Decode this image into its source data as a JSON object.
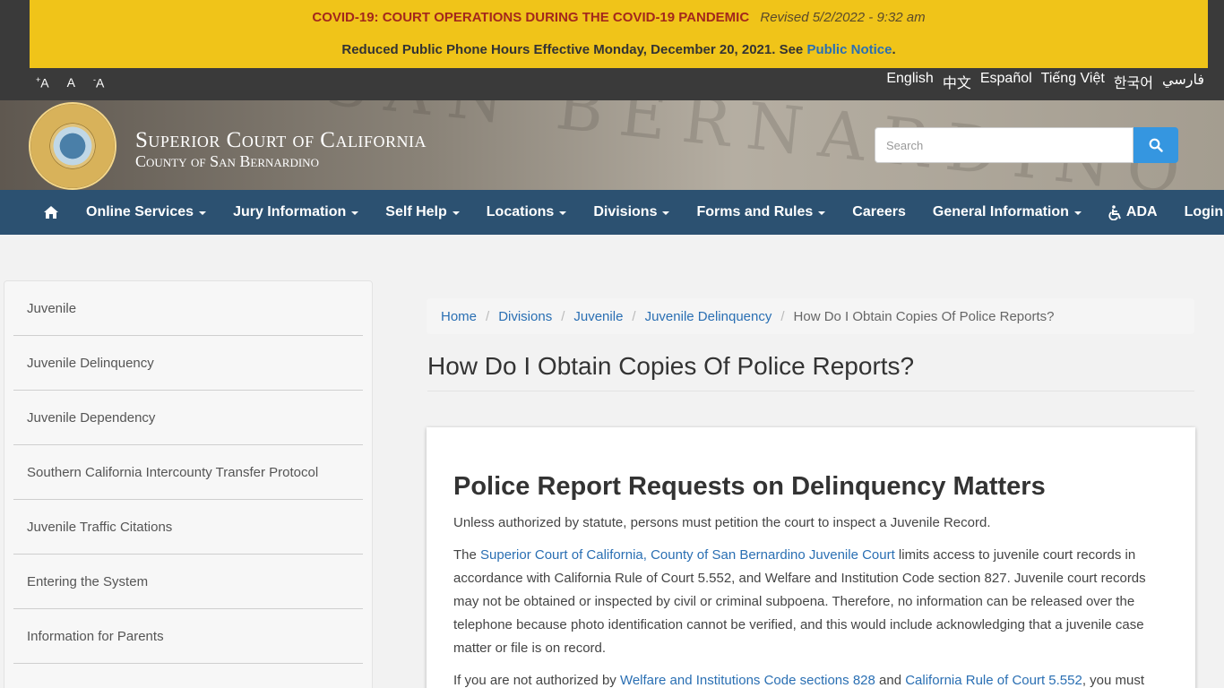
{
  "alert": {
    "title": "COVID-19: COURT OPERATIONS DURING THE COVID-19 PANDEMIC",
    "revised": "Revised 5/2/2022 - 9:32 am",
    "line2_text": "Reduced Public Phone Hours Effective Monday, December 20, 2021. See ",
    "line2_link": "Public Notice",
    "line2_end": "."
  },
  "font_size": {
    "increase": "A",
    "normal": "A",
    "decrease": "A"
  },
  "languages": [
    "English",
    "中文",
    "Español",
    "Tiếng Việt",
    "한국어",
    "فارسي"
  ],
  "site": {
    "title_line1": "Superior Court of California",
    "title_line2": "County of San Bernardino",
    "engraving": "SAN BERNARDINO JUS"
  },
  "search": {
    "placeholder": "Search"
  },
  "nav": {
    "items": [
      {
        "label": "Online Services",
        "dropdown": true
      },
      {
        "label": "Jury Information",
        "dropdown": true
      },
      {
        "label": "Self Help",
        "dropdown": true
      },
      {
        "label": "Locations",
        "dropdown": true
      },
      {
        "label": "Divisions",
        "dropdown": true
      },
      {
        "label": "Forms and Rules",
        "dropdown": true
      },
      {
        "label": "Careers",
        "dropdown": false
      },
      {
        "label": "General Information",
        "dropdown": true
      },
      {
        "label": "ADA",
        "dropdown": false
      },
      {
        "label": "Login",
        "dropdown": false
      }
    ]
  },
  "sidebar": {
    "items": [
      {
        "label": "Juvenile"
      },
      {
        "label": "Juvenile Delinquency"
      },
      {
        "label": "Juvenile Dependency"
      },
      {
        "label": "Southern California Intercounty Transfer Protocol"
      },
      {
        "label": "Juvenile Traffic Citations"
      },
      {
        "label": "Entering the System"
      },
      {
        "label": "Information for Parents"
      }
    ]
  },
  "breadcrumb": {
    "items": [
      "Home",
      "Divisions",
      "Juvenile",
      "Juvenile Delinquency"
    ],
    "current": "How Do I Obtain Copies Of Police Reports?"
  },
  "page": {
    "title": "How Do I Obtain Copies Of Police Reports?"
  },
  "content": {
    "heading": "Police Report Requests on Delinquency Matters",
    "p1": "Unless authorized by statute, persons must petition the court to inspect a Juvenile Record.",
    "p2_start": "The ",
    "p2_link": "Superior Court of California, County of San Bernardino Juvenile Court",
    "p2_rest": " limits access to juvenile court records in accordance with California Rule of Court 5.552, and Welfare and Institution Code section 827. Juvenile court records may not be obtained or inspected by civil or criminal subpoena. Therefore, no information can be released over the telephone because photo identification cannot be verified, and this would include acknowledging that a juvenile case matter or file is on record.",
    "p3_start": "If you are not authorized by ",
    "p3_link1": "Welfare and Institutions Code sections 828",
    "p3_mid": " and ",
    "p3_link2": "California Rule of Court 5.552",
    "p3_end": ", you must"
  },
  "colors": {
    "alert_bg": "#f0c419",
    "alert_title": "#a3281c",
    "nav_bg": "#2c5171",
    "search_button": "#3596e0",
    "link": "#2a6fb3"
  },
  "icons": {
    "home": "home-icon",
    "search": "search-icon",
    "ada": "wheelchair-icon"
  }
}
